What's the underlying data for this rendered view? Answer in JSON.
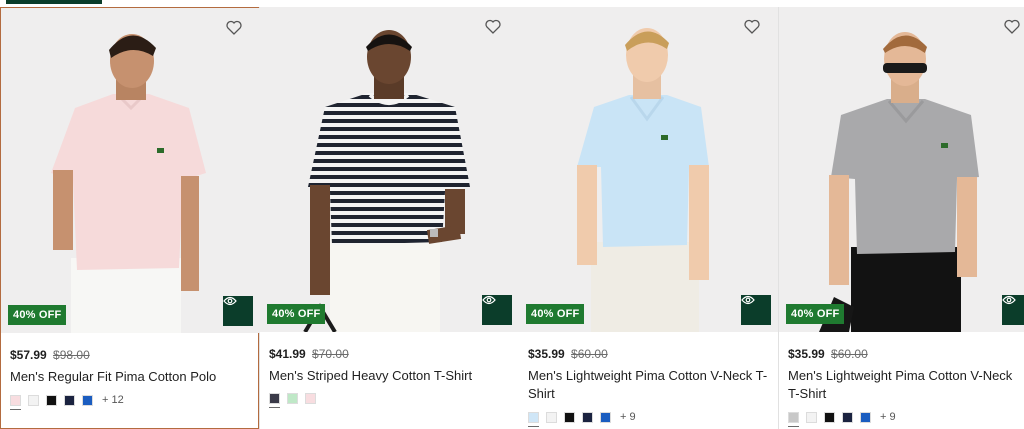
{
  "colors": {
    "badge": "#1f7a30",
    "quick_view": "#0b3d2a",
    "image_bg": "#efeeee"
  },
  "products": [
    {
      "badge": "40% OFF",
      "price": "$57.99",
      "old_price": "$98.00",
      "name": "Men's Regular Fit Pima Cotton Polo",
      "swatches": [
        "#f8dde0",
        "#f3f3f3",
        "#111111",
        "#1b2340",
        "#1b5dc0"
      ],
      "more": "+ 12"
    },
    {
      "badge": "40% OFF",
      "price": "$41.99",
      "old_price": "$70.00",
      "name": "Men's Striped Heavy Cotton T-Shirt",
      "swatches": [
        "#3a3a48",
        "#bfe8c7",
        "#f8dde0"
      ],
      "more": ""
    },
    {
      "badge": "40% OFF",
      "price": "$35.99",
      "old_price": "$60.00",
      "name": "Men's Lightweight Pima Cotton V-Neck T-Shirt",
      "swatches": [
        "#cfe6f7",
        "#f3f3f3",
        "#111111",
        "#1b2340",
        "#1b5dc0"
      ],
      "more": "+ 9"
    },
    {
      "badge": "40% OFF",
      "price": "$35.99",
      "old_price": "$60.00",
      "name": "Men's Lightweight Pima Cotton V-Neck T-Shirt",
      "swatches": [
        "#c8c8c8",
        "#f3f3f3",
        "#111111",
        "#1b2340",
        "#1b5dc0"
      ],
      "more": "+ 9"
    }
  ]
}
